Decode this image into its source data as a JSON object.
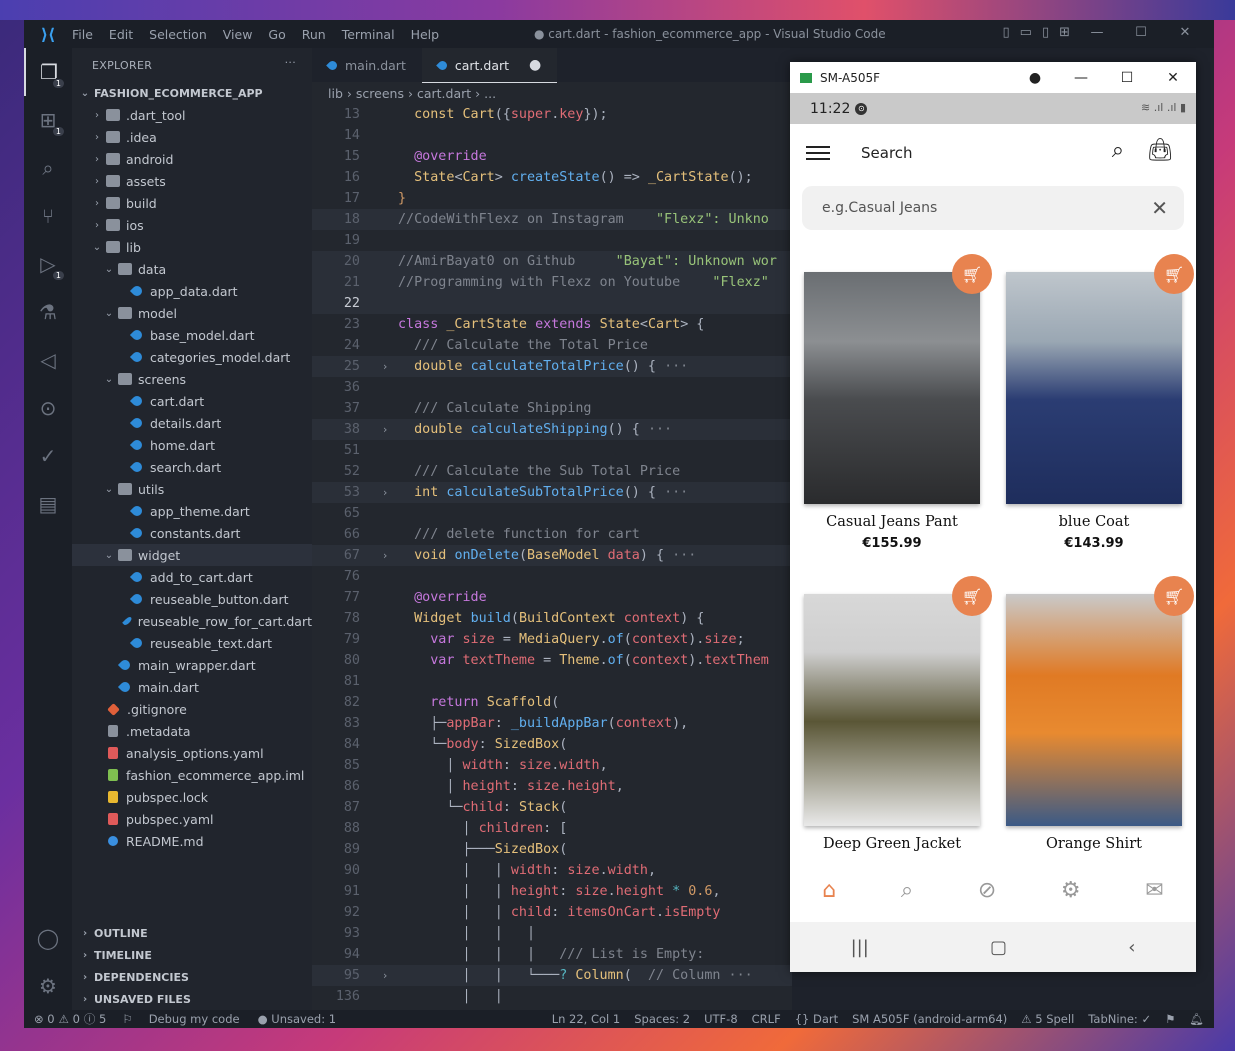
{
  "window": {
    "title": "● cart.dart - fashion_ecommerce_app - Visual Studio Code",
    "menu": [
      "File",
      "Edit",
      "Selection",
      "View",
      "Go",
      "Run",
      "Terminal",
      "Help"
    ]
  },
  "explorer": {
    "header": "EXPLORER",
    "more": "···",
    "root": "FASHION_ECOMMERCE_APP",
    "rows": [
      {
        "label": ".dart_tool",
        "depth": 1,
        "chev": "›",
        "icon": "folder"
      },
      {
        "label": ".idea",
        "depth": 1,
        "chev": "›",
        "icon": "folder"
      },
      {
        "label": "android",
        "depth": 1,
        "chev": "›",
        "icon": "folder"
      },
      {
        "label": "assets",
        "depth": 1,
        "chev": "›",
        "icon": "folder"
      },
      {
        "label": "build",
        "depth": 1,
        "chev": "›",
        "icon": "folder"
      },
      {
        "label": "ios",
        "depth": 1,
        "chev": "›",
        "icon": "folder"
      },
      {
        "label": "lib",
        "depth": 1,
        "chev": "⌄",
        "icon": "folder"
      },
      {
        "label": "data",
        "depth": 2,
        "chev": "⌄",
        "icon": "folder"
      },
      {
        "label": "app_data.dart",
        "depth": 3,
        "chev": "",
        "icon": "dart"
      },
      {
        "label": "model",
        "depth": 2,
        "chev": "⌄",
        "icon": "folder"
      },
      {
        "label": "base_model.dart",
        "depth": 3,
        "chev": "",
        "icon": "dart"
      },
      {
        "label": "categories_model.dart",
        "depth": 3,
        "chev": "",
        "icon": "dart"
      },
      {
        "label": "screens",
        "depth": 2,
        "chev": "⌄",
        "icon": "folder"
      },
      {
        "label": "cart.dart",
        "depth": 3,
        "chev": "",
        "icon": "dart"
      },
      {
        "label": "details.dart",
        "depth": 3,
        "chev": "",
        "icon": "dart"
      },
      {
        "label": "home.dart",
        "depth": 3,
        "chev": "",
        "icon": "dart"
      },
      {
        "label": "search.dart",
        "depth": 3,
        "chev": "",
        "icon": "dart"
      },
      {
        "label": "utils",
        "depth": 2,
        "chev": "⌄",
        "icon": "folder"
      },
      {
        "label": "app_theme.dart",
        "depth": 3,
        "chev": "",
        "icon": "dart"
      },
      {
        "label": "constants.dart",
        "depth": 3,
        "chev": "",
        "icon": "dart"
      },
      {
        "label": "widget",
        "depth": 2,
        "chev": "⌄",
        "icon": "folder",
        "selected": true
      },
      {
        "label": "add_to_cart.dart",
        "depth": 3,
        "chev": "",
        "icon": "dart"
      },
      {
        "label": "reuseable_button.dart",
        "depth": 3,
        "chev": "",
        "icon": "dart"
      },
      {
        "label": "reuseable_row_for_cart.dart",
        "depth": 3,
        "chev": "",
        "icon": "dart"
      },
      {
        "label": "reuseable_text.dart",
        "depth": 3,
        "chev": "",
        "icon": "dart"
      },
      {
        "label": "main_wrapper.dart",
        "depth": 2,
        "chev": "",
        "icon": "dart"
      },
      {
        "label": "main.dart",
        "depth": 2,
        "chev": "",
        "icon": "dart"
      },
      {
        "label": ".gitignore",
        "depth": 1,
        "chev": "",
        "icon": "git"
      },
      {
        "label": ".metadata",
        "depth": 1,
        "chev": "",
        "icon": "meta"
      },
      {
        "label": "analysis_options.yaml",
        "depth": 1,
        "chev": "",
        "icon": "yaml"
      },
      {
        "label": "fashion_ecommerce_app.iml",
        "depth": 1,
        "chev": "",
        "icon": "iml"
      },
      {
        "label": "pubspec.lock",
        "depth": 1,
        "chev": "",
        "icon": "lock"
      },
      {
        "label": "pubspec.yaml",
        "depth": 1,
        "chev": "",
        "icon": "yaml"
      },
      {
        "label": "README.md",
        "depth": 1,
        "chev": "",
        "icon": "info"
      }
    ],
    "sections": [
      "OUTLINE",
      "TIMELINE",
      "DEPENDENCIES",
      "UNSAVED FILES"
    ]
  },
  "editor": {
    "tabs": [
      {
        "label": "main.dart",
        "active": false
      },
      {
        "label": "cart.dart",
        "active": true,
        "dirty": "●"
      }
    ],
    "breadcrumb": [
      "lib",
      "screens",
      "cart.dart",
      "..."
    ],
    "lines": [
      {
        "n": "13",
        "fold": "",
        "code": [
          [
            "pl",
            "  "
          ],
          [
            "ty",
            "const "
          ],
          [
            "ty",
            "Cart"
          ],
          [
            "pl",
            "({"
          ],
          [
            "vr",
            "super"
          ],
          [
            "pl",
            "."
          ],
          [
            "vr",
            "key"
          ],
          [
            "pl",
            "});"
          ]
        ]
      },
      {
        "n": "14",
        "fold": "",
        "code": []
      },
      {
        "n": "15",
        "fold": "",
        "code": [
          [
            "pl",
            "  "
          ],
          [
            "kw",
            "@override"
          ]
        ]
      },
      {
        "n": "16",
        "fold": "",
        "code": [
          [
            "pl",
            "  "
          ],
          [
            "ty",
            "State"
          ],
          [
            "pl",
            "<"
          ],
          [
            "ty",
            "Cart"
          ],
          [
            "pl",
            "> "
          ],
          [
            "fn",
            "createState"
          ],
          [
            "pl",
            "() => "
          ],
          [
            "ty",
            "_CartState"
          ],
          [
            "pl",
            "();"
          ]
        ]
      },
      {
        "n": "17",
        "fold": "",
        "code": [
          [
            "nm",
            "}"
          ]
        ]
      },
      {
        "n": "18",
        "fold": "",
        "hl": true,
        "code": [
          [
            "cm",
            "//CodeWithFlexz on Instagram    "
          ],
          [
            "st",
            "\"Flexz\": Unkno"
          ]
        ]
      },
      {
        "n": "19",
        "fold": "",
        "code": []
      },
      {
        "n": "20",
        "fold": "",
        "hl": true,
        "code": [
          [
            "cm",
            "//AmirBayat0 on Github     "
          ],
          [
            "st",
            "\"Bayat\": Unknown wor"
          ]
        ]
      },
      {
        "n": "21",
        "fold": "",
        "hl": true,
        "code": [
          [
            "cm",
            "//Programming with Flexz on Youtube    "
          ],
          [
            "st",
            "\"Flexz\""
          ]
        ]
      },
      {
        "n": "22",
        "fold": "",
        "cur": true,
        "hl": true,
        "code": []
      },
      {
        "n": "23",
        "fold": "",
        "code": [
          [
            "kw",
            "class "
          ],
          [
            "ty",
            "_CartState "
          ],
          [
            "kw",
            "extends "
          ],
          [
            "ty",
            "State"
          ],
          [
            "pl",
            "<"
          ],
          [
            "ty",
            "Cart"
          ],
          [
            "pl",
            "> {"
          ]
        ]
      },
      {
        "n": "24",
        "fold": "",
        "code": [
          [
            "cm",
            "  /// Calculate the Total Price"
          ]
        ]
      },
      {
        "n": "25",
        "fold": "›",
        "hl": true,
        "code": [
          [
            "pl",
            "  "
          ],
          [
            "ty",
            "double "
          ],
          [
            "fn",
            "calculateTotalPrice"
          ],
          [
            "pl",
            "() { "
          ],
          [
            "cm",
            "···"
          ]
        ]
      },
      {
        "n": "36",
        "fold": "",
        "code": []
      },
      {
        "n": "37",
        "fold": "",
        "code": [
          [
            "cm",
            "  /// Calculate Shipping"
          ]
        ]
      },
      {
        "n": "38",
        "fold": "›",
        "hl": true,
        "code": [
          [
            "pl",
            "  "
          ],
          [
            "ty",
            "double "
          ],
          [
            "fn",
            "calculateShipping"
          ],
          [
            "pl",
            "() { "
          ],
          [
            "cm",
            "···"
          ]
        ]
      },
      {
        "n": "51",
        "fold": "",
        "code": []
      },
      {
        "n": "52",
        "fold": "",
        "code": [
          [
            "cm",
            "  /// Calculate the Sub Total Price"
          ]
        ]
      },
      {
        "n": "53",
        "fold": "›",
        "hl": true,
        "code": [
          [
            "pl",
            "  "
          ],
          [
            "ty",
            "int "
          ],
          [
            "fn",
            "calculateSubTotalPrice"
          ],
          [
            "pl",
            "() { "
          ],
          [
            "cm",
            "···"
          ]
        ]
      },
      {
        "n": "65",
        "fold": "",
        "code": []
      },
      {
        "n": "66",
        "fold": "",
        "code": [
          [
            "cm",
            "  /// delete function for cart"
          ]
        ]
      },
      {
        "n": "67",
        "fold": "›",
        "hl": true,
        "code": [
          [
            "pl",
            "  "
          ],
          [
            "ty",
            "void "
          ],
          [
            "fn",
            "onDelete"
          ],
          [
            "pl",
            "("
          ],
          [
            "ty",
            "BaseModel "
          ],
          [
            "vr",
            "data"
          ],
          [
            "pl",
            ") { "
          ],
          [
            "cm",
            "···"
          ]
        ]
      },
      {
        "n": "76",
        "fold": "",
        "code": []
      },
      {
        "n": "77",
        "fold": "",
        "code": [
          [
            "pl",
            "  "
          ],
          [
            "kw",
            "@override"
          ]
        ]
      },
      {
        "n": "78",
        "fold": "",
        "code": [
          [
            "pl",
            "  "
          ],
          [
            "ty",
            "Widget "
          ],
          [
            "fn",
            "build"
          ],
          [
            "pl",
            "("
          ],
          [
            "ty",
            "BuildContext "
          ],
          [
            "vr",
            "context"
          ],
          [
            "pl",
            ") {"
          ]
        ]
      },
      {
        "n": "79",
        "fold": "",
        "code": [
          [
            "pl",
            "    "
          ],
          [
            "kw",
            "var "
          ],
          [
            "vr",
            "size "
          ],
          [
            "pl",
            "= "
          ],
          [
            "ty",
            "MediaQuery"
          ],
          [
            "pl",
            "."
          ],
          [
            "fn",
            "of"
          ],
          [
            "pl",
            "("
          ],
          [
            "vr",
            "context"
          ],
          [
            "pl",
            ")."
          ],
          [
            "vr",
            "size"
          ],
          [
            "pl",
            ";"
          ]
        ]
      },
      {
        "n": "80",
        "fold": "",
        "code": [
          [
            "pl",
            "    "
          ],
          [
            "kw",
            "var "
          ],
          [
            "vr",
            "textTheme "
          ],
          [
            "pl",
            "= "
          ],
          [
            "ty",
            "Theme"
          ],
          [
            "pl",
            "."
          ],
          [
            "fn",
            "of"
          ],
          [
            "pl",
            "("
          ],
          [
            "vr",
            "context"
          ],
          [
            "pl",
            ")."
          ],
          [
            "vr",
            "textThem"
          ]
        ]
      },
      {
        "n": "81",
        "fold": "",
        "code": []
      },
      {
        "n": "82",
        "fold": "",
        "code": [
          [
            "pl",
            "    "
          ],
          [
            "kw",
            "return "
          ],
          [
            "ty",
            "Scaffold"
          ],
          [
            "pl",
            "("
          ]
        ]
      },
      {
        "n": "83",
        "fold": "",
        "code": [
          [
            "pl",
            "    ├─"
          ],
          [
            "vr",
            "appBar"
          ],
          [
            "pl",
            ": "
          ],
          [
            "fn",
            "_buildAppBar"
          ],
          [
            "pl",
            "("
          ],
          [
            "vr",
            "context"
          ],
          [
            "pl",
            "),"
          ]
        ]
      },
      {
        "n": "84",
        "fold": "",
        "code": [
          [
            "pl",
            "    └─"
          ],
          [
            "vr",
            "body"
          ],
          [
            "pl",
            ": "
          ],
          [
            "ty",
            "SizedBox"
          ],
          [
            "pl",
            "("
          ]
        ]
      },
      {
        "n": "85",
        "fold": "",
        "code": [
          [
            "pl",
            "      │ "
          ],
          [
            "vr",
            "width"
          ],
          [
            "pl",
            ": "
          ],
          [
            "vr",
            "size"
          ],
          [
            "pl",
            "."
          ],
          [
            "vr",
            "width"
          ],
          [
            "pl",
            ","
          ]
        ]
      },
      {
        "n": "86",
        "fold": "",
        "code": [
          [
            "pl",
            "      │ "
          ],
          [
            "vr",
            "height"
          ],
          [
            "pl",
            ": "
          ],
          [
            "vr",
            "size"
          ],
          [
            "pl",
            "."
          ],
          [
            "vr",
            "height"
          ],
          [
            "pl",
            ","
          ]
        ]
      },
      {
        "n": "87",
        "fold": "",
        "code": [
          [
            "pl",
            "      └─"
          ],
          [
            "vr",
            "child"
          ],
          [
            "pl",
            ": "
          ],
          [
            "ty",
            "Stack"
          ],
          [
            "pl",
            "("
          ]
        ]
      },
      {
        "n": "88",
        "fold": "",
        "code": [
          [
            "pl",
            "        │ "
          ],
          [
            "vr",
            "children"
          ],
          [
            "pl",
            ": ["
          ]
        ]
      },
      {
        "n": "89",
        "fold": "",
        "code": [
          [
            "pl",
            "        ├───"
          ],
          [
            "ty",
            "SizedBox"
          ],
          [
            "pl",
            "("
          ]
        ]
      },
      {
        "n": "90",
        "fold": "",
        "code": [
          [
            "pl",
            "        │   │ "
          ],
          [
            "vr",
            "width"
          ],
          [
            "pl",
            ": "
          ],
          [
            "vr",
            "size"
          ],
          [
            "pl",
            "."
          ],
          [
            "vr",
            "width"
          ],
          [
            "pl",
            ","
          ]
        ]
      },
      {
        "n": "91",
        "fold": "",
        "code": [
          [
            "pl",
            "        │   │ "
          ],
          [
            "vr",
            "height"
          ],
          [
            "pl",
            ": "
          ],
          [
            "vr",
            "size"
          ],
          [
            "pl",
            "."
          ],
          [
            "vr",
            "height "
          ],
          [
            "tb",
            "* "
          ],
          [
            "nm",
            "0.6"
          ],
          [
            "pl",
            ","
          ]
        ]
      },
      {
        "n": "92",
        "fold": "",
        "code": [
          [
            "pl",
            "        │   │ "
          ],
          [
            "vr",
            "child"
          ],
          [
            "pl",
            ": "
          ],
          [
            "vr",
            "itemsOnCart"
          ],
          [
            "pl",
            "."
          ],
          [
            "vr",
            "isEmpty"
          ]
        ]
      },
      {
        "n": "93",
        "fold": "",
        "code": [
          [
            "pl",
            "        │   │   │"
          ]
        ]
      },
      {
        "n": "94",
        "fold": "",
        "code": [
          [
            "pl",
            "        │   │   │   "
          ],
          [
            "cm",
            "/// List is Empty:"
          ]
        ]
      },
      {
        "n": "95",
        "fold": "›",
        "hl": true,
        "code": [
          [
            "pl",
            "        │   │   └───"
          ],
          [
            "tb",
            "? "
          ],
          [
            "ty",
            "Column"
          ],
          [
            "pl",
            "(  "
          ],
          [
            "cm",
            "// Column ···"
          ]
        ]
      },
      {
        "n": "136",
        "fold": "",
        "code": [
          [
            "pl",
            "        │   │"
          ]
        ]
      }
    ]
  },
  "status": {
    "errors": "⊗ 0",
    "warnings": "⚠ 0",
    "info": "ⓘ 5",
    "debug": "Debug my code",
    "unsaved": "Unsaved: 1",
    "position": "Ln 22, Col 1",
    "spaces": "Spaces: 2",
    "encoding": "UTF-8",
    "eol": "CRLF",
    "lang": "{} Dart",
    "device": "SM A505F (android-arm64)",
    "spell": "⚠ 5 Spell",
    "tabnine": "TabNine: ✓"
  },
  "emulator": {
    "title": "SM-A505F",
    "time": "11:22",
    "search_title": "Search",
    "search_placeholder": "e.g.Casual Jeans",
    "products": [
      {
        "name": "Casual Jeans Pant",
        "price": "€155.99"
      },
      {
        "name": "blue Coat",
        "price": "€143.99"
      },
      {
        "name": "Deep Green Jacket",
        "price": ""
      },
      {
        "name": "Orange Shirt",
        "price": ""
      }
    ],
    "accent": "#e8834f"
  }
}
